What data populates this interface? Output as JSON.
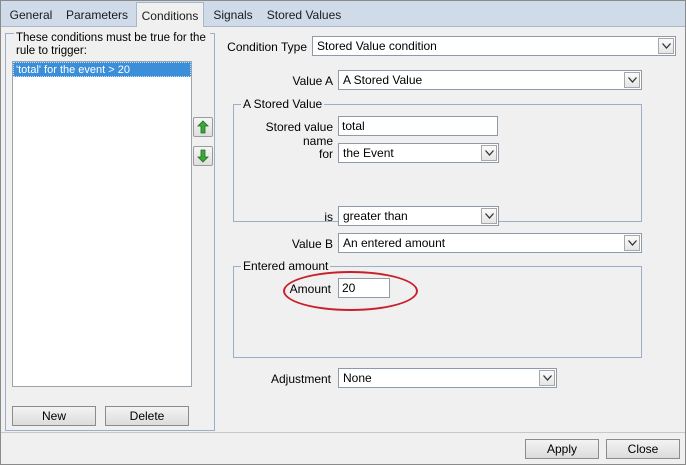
{
  "tabs": [
    {
      "label": "General",
      "active": false
    },
    {
      "label": "Parameters",
      "active": false
    },
    {
      "label": "Conditions",
      "active": true
    },
    {
      "label": "Signals",
      "active": false
    },
    {
      "label": "Stored Values",
      "active": false
    }
  ],
  "left": {
    "legend": "These conditions must be true for the rule to trigger:",
    "items": [
      "'total' for the event > 20"
    ],
    "new_label": "New",
    "delete_label": "Delete",
    "up_icon": "arrow-up-icon",
    "down_icon": "arrow-down-icon"
  },
  "form": {
    "condition_type_label": "Condition Type",
    "condition_type_value": "Stored Value condition",
    "value_a_label": "Value A",
    "value_a_value": "A Stored Value",
    "stored_group_title": "A Stored Value",
    "stored_name_label": "Stored value name",
    "stored_name_value": "total",
    "for_label": "for",
    "for_value": "the Event",
    "is_label": "is",
    "is_value": "greater than",
    "value_b_label": "Value B",
    "value_b_value": "An entered amount",
    "entered_group_title": "Entered amount",
    "amount_label": "Amount",
    "amount_value": "20",
    "adjustment_label": "Adjustment",
    "adjustment_value": "None"
  },
  "footer": {
    "apply_label": "Apply",
    "close_label": "Close"
  },
  "colors": {
    "selection": "#3b8fd8",
    "highlight_ellipse": "#c8202a",
    "tabstrip": "#cfdbe8"
  }
}
